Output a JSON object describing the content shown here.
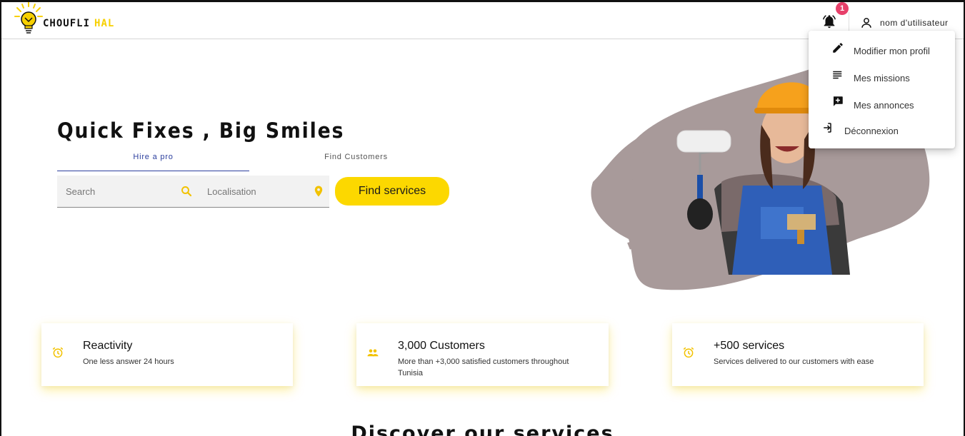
{
  "brand": {
    "name_part1": "CHOUFLI",
    "name_part2": "HAL",
    "accent": "#fcd800"
  },
  "header": {
    "notification_count": "1",
    "username": "nom d'utilisateur"
  },
  "menu": {
    "items": [
      {
        "label": "Modifier mon profil",
        "icon": "pencil-icon"
      },
      {
        "label": "Mes missions",
        "icon": "list-icon"
      },
      {
        "label": "Mes annonces",
        "icon": "add-box-icon"
      },
      {
        "label": "Déconnexion",
        "icon": "logout-icon"
      }
    ]
  },
  "hero": {
    "title": "Quick Fixes , Big Smiles",
    "tabs": [
      {
        "label": "Hire a pro",
        "active": true
      },
      {
        "label": "Find Customers",
        "active": false
      }
    ],
    "search": {
      "placeholder": "Search"
    },
    "location": {
      "placeholder": "Localisation"
    },
    "find_button": "Find services"
  },
  "stats": [
    {
      "title": "Reactivity",
      "desc": "One less answer 24 hours",
      "icon": "alarm-icon"
    },
    {
      "title": "3,000 Customers",
      "desc": "More than +3,000 satisfied customers throughout Tunisia",
      "icon": "people-icon"
    },
    {
      "title": "+500 services",
      "desc": "Services delivered to our customers with ease",
      "icon": "alarm-icon"
    }
  ],
  "discover_title": "Discover our services"
}
